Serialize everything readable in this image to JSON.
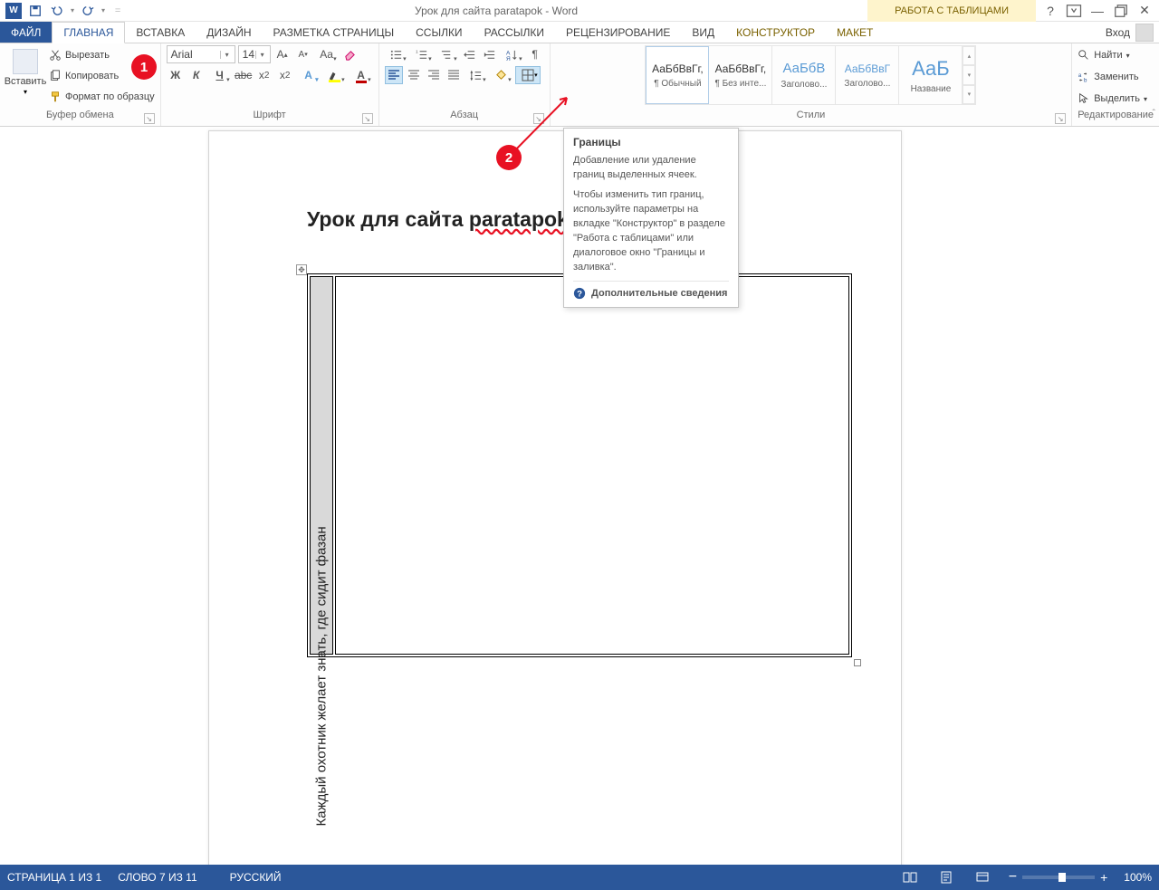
{
  "title": "Урок для сайта paratapok - Word",
  "table_tools_label": "РАБОТА С ТАБЛИЦАМИ",
  "login_label": "Вход",
  "tabs": {
    "file": "ФАЙЛ",
    "home": "ГЛАВНАЯ",
    "insert": "ВСТАВКА",
    "design": "ДИЗАЙН",
    "layout": "РАЗМЕТКА СТРАНИЦЫ",
    "references": "ССЫЛКИ",
    "mailings": "РАССЫЛКИ",
    "review": "РЕЦЕНЗИРОВАНИЕ",
    "view": "ВИД",
    "constructor": "КОНСТРУКТОР",
    "maket": "МАКЕТ"
  },
  "clipboard": {
    "paste": "Вставить",
    "cut": "Вырезать",
    "copy": "Копировать",
    "format_painter": "Формат по образцу",
    "group": "Буфер обмена"
  },
  "font": {
    "name": "Arial",
    "size": "14",
    "group": "Шрифт",
    "bold": "Ж",
    "italic": "К",
    "underline": "Ч"
  },
  "paragraph": {
    "group": "Абзац"
  },
  "styles": {
    "group": "Стили",
    "s1_preview": "АаБбВвГг,",
    "s1_name": "¶ Обычный",
    "s2_preview": "АаБбВвГг,",
    "s2_name": "¶ Без инте...",
    "s3_preview": "АаБбВ",
    "s3_name": "Заголово...",
    "s4_preview": "АаБбВвГ",
    "s4_name": "Заголово...",
    "s5_preview": "АаБ",
    "s5_name": "Название"
  },
  "editing": {
    "group": "Редактирование",
    "find": "Найти",
    "replace": "Заменить",
    "select": "Выделить"
  },
  "tooltip": {
    "title": "Границы",
    "p1": "Добавление или удаление границ выделенных ячеек.",
    "p2": "Чтобы изменить тип границ, используйте параметры на вкладке \"Конструктор\" в разделе \"Работа с таблицами\" или диалоговое окно \"Границы и заливка\".",
    "more": "Дополнительные сведения"
  },
  "document": {
    "heading_pre": "Урок для сайта ",
    "heading_link": "paratapok",
    "cell_text": "Каждый охотник желает  знать, где сидит фазан"
  },
  "markers": {
    "m1": "1",
    "m2": "2"
  },
  "status": {
    "page": "СТРАНИЦА 1 ИЗ 1",
    "words": "СЛОВО 7 ИЗ 11",
    "lang": "РУССКИЙ",
    "zoom": "100%"
  }
}
